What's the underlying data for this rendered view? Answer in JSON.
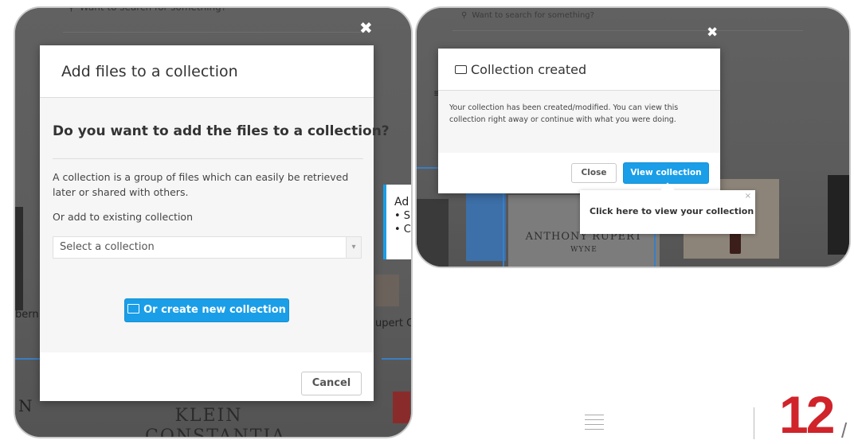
{
  "left": {
    "search_placeholder": "Want to search for something?",
    "modal": {
      "title": "Add files to a collection",
      "question": "Do you want to add the files to a collection?",
      "description": "A collection is a group of files which can easily be retrieved later or shared with others.",
      "existing_label": "Or add to existing collection",
      "select_value": "Select a collection",
      "create_button": "Or create new collection",
      "cancel_button": "Cancel"
    },
    "bg": {
      "tooltip_title": "Ad",
      "tooltip_line1": "• S",
      "tooltip_line2": "• C",
      "left_text": "bern",
      "right_text": "upert C",
      "bottom_letter": "N",
      "label_line1": "KLEIN",
      "label_line2": "CONSTANTIA"
    }
  },
  "right": {
    "search_placeholder": "Want to search for something?",
    "modal": {
      "title": "Collection created",
      "message": "Your collection has been created/modified. You can view this collection right away or continue with what you were doing.",
      "close_button": "Close",
      "view_button": "View collection"
    },
    "tooltip": {
      "text": "Click here to view your collection",
      "close": "×"
    },
    "bg": {
      "label_line1": "ANTHONY RUPERT",
      "label_line2": "WYNE"
    }
  },
  "footer": {
    "page_number": "12",
    "slash": "/",
    "accent_color": "#d0232a"
  },
  "icons": {
    "close": "✖",
    "search": "⚲",
    "image": "🖼",
    "inbox": "⌂",
    "menu": "≡",
    "select_arrow": "▾"
  }
}
